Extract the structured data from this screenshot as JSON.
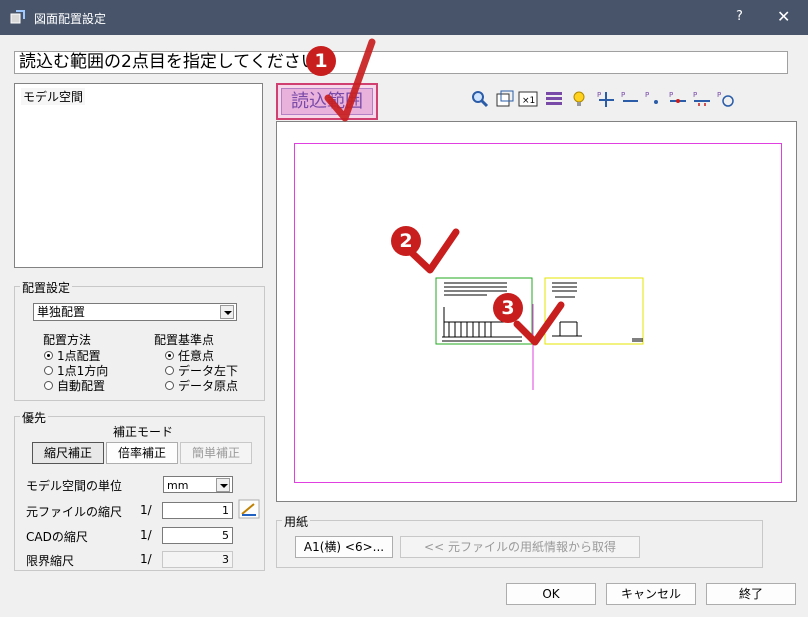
{
  "window": {
    "title": "図面配置設定",
    "help": "?",
    "close": "✕"
  },
  "prompt": "読込む範囲の2点目を指定してください",
  "model_list": {
    "items": [
      "モデル空間"
    ]
  },
  "placement": {
    "group_label": "配置設定",
    "mode_value": "単独配置",
    "method_label": "配置方法",
    "method_options": [
      "1点配置",
      "1点1方向",
      "自動配置"
    ],
    "method_selected": 0,
    "base_label": "配置基準点",
    "base_options": [
      "任意点",
      "データ左下",
      "データ原点"
    ],
    "base_selected": 0
  },
  "priority": {
    "group_label": "優先",
    "correction_label": "補正モード",
    "buttons": [
      "縮尺補正",
      "倍率補正",
      "簡単補正"
    ],
    "unit_label": "モデル空間の単位",
    "unit_value": "mm",
    "src_scale_label": "元ファイルの縮尺",
    "cad_scale_label": "CADの縮尺",
    "limit_scale_label": "限界縮尺",
    "prefix": "1/",
    "src_scale": "1",
    "cad_scale": "5",
    "limit_scale": "3"
  },
  "read_range_label": "読込範囲",
  "paper": {
    "group_label": "用紙",
    "size_button": "A1(横) <6>...",
    "get_button": "<< 元ファイルの用紙情報から取得"
  },
  "footer": {
    "ok": "OK",
    "cancel": "キャンセル",
    "exit": "終了"
  },
  "callouts": [
    "1",
    "2",
    "3"
  ],
  "colors": {
    "title_bg": "#47546a",
    "sheet_border": "#e040e0",
    "callout": "#c81e1e",
    "accent_pink": "#e9b2dd"
  }
}
